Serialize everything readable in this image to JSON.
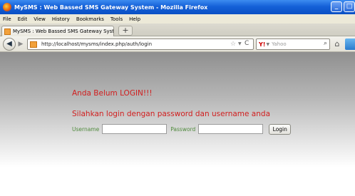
{
  "window": {
    "title": "MySMS : Web Bassed SMS Gateway System - Mozilla Firefox"
  },
  "menu": {
    "items": [
      "File",
      "Edit",
      "View",
      "History",
      "Bookmarks",
      "Tools",
      "Help"
    ]
  },
  "tab": {
    "label": "MySMS : Web Bassed SMS Gateway System",
    "new_tab_symbol": "+"
  },
  "navbar": {
    "url": "http://localhost/mysms/index.php/auth/login",
    "search_placeholder": "Yahoo",
    "search_engine_icon": "yahoo-icon"
  },
  "page": {
    "warning": "Anda Belum LOGIN!!!",
    "instruction": "Silahkan login dengan password dan username anda",
    "username_label": "Username",
    "username_value": "",
    "password_label": "Password",
    "password_value": "",
    "login_button": "Login"
  },
  "colors": {
    "warning_text": "#d12020",
    "label_text": "#4f8a3c",
    "titlebar": "#1561d8"
  }
}
